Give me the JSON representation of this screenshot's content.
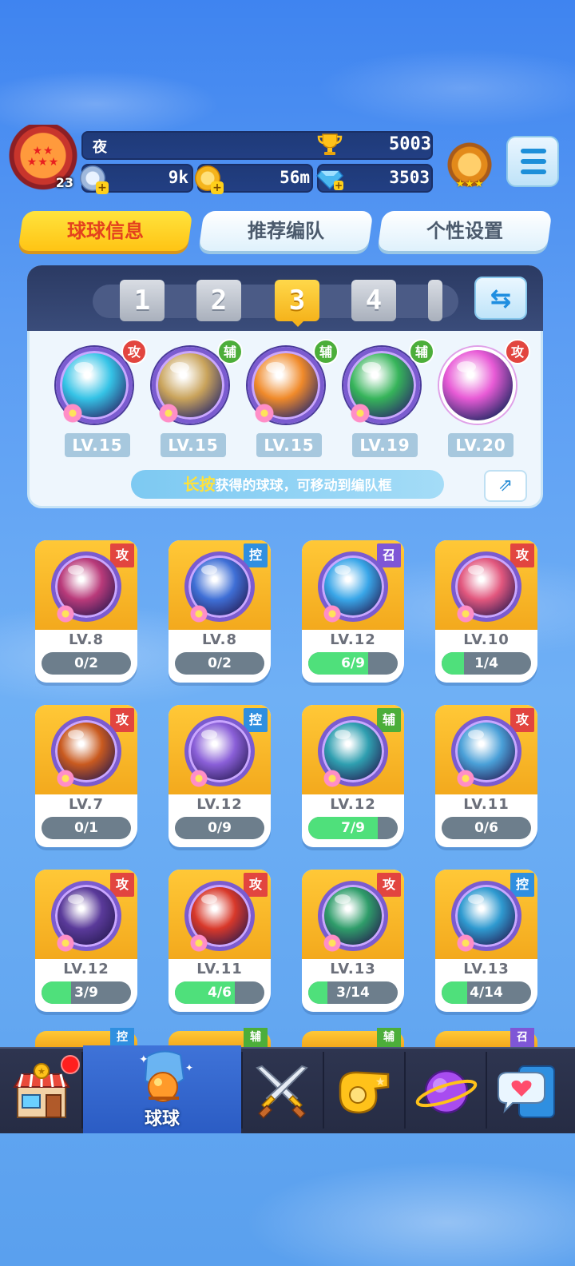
{
  "player": {
    "name": "夜",
    "level": "23",
    "trophies": "5003",
    "coins": "9k",
    "gold": "56m",
    "gems": "3503"
  },
  "tabs": [
    {
      "label": "球球信息",
      "active": true
    },
    {
      "label": "推荐编队",
      "active": false
    },
    {
      "label": "个性设置",
      "active": false
    }
  ],
  "team": {
    "slots": [
      "1",
      "2",
      "3",
      "4"
    ],
    "active_slot": "3",
    "balls": [
      {
        "type": "攻",
        "level": "LV.15",
        "color": "#35c3e6"
      },
      {
        "type": "辅",
        "level": "LV.15",
        "color": "#c9a35b"
      },
      {
        "type": "辅",
        "level": "LV.15",
        "color": "#f08a2a"
      },
      {
        "type": "辅",
        "level": "LV.19",
        "color": "#36b45a"
      },
      {
        "type": "攻",
        "level": "LV.20",
        "color": "#e85bd6"
      }
    ],
    "tip_highlight": "长按",
    "tip_text": "获得的球球，可移动到编队框"
  },
  "cards": [
    {
      "type": "攻",
      "level": "LV.8",
      "progress": "0/2",
      "fill": 0,
      "color": "#b93a7a"
    },
    {
      "type": "控",
      "level": "LV.8",
      "progress": "0/2",
      "fill": 0,
      "color": "#3f6fd6"
    },
    {
      "type": "召",
      "level": "LV.12",
      "progress": "6/9",
      "fill": 0.67,
      "color": "#39a6e8"
    },
    {
      "type": "攻",
      "level": "LV.10",
      "progress": "1/4",
      "fill": 0.25,
      "color": "#e2577e"
    },
    {
      "type": "攻",
      "level": "LV.7",
      "progress": "0/1",
      "fill": 0,
      "color": "#c95a1f"
    },
    {
      "type": "控",
      "level": "LV.12",
      "progress": "0/9",
      "fill": 0,
      "color": "#8a5fd8"
    },
    {
      "type": "辅",
      "level": "LV.12",
      "progress": "7/9",
      "fill": 0.78,
      "color": "#2f9fb0"
    },
    {
      "type": "攻",
      "level": "LV.11",
      "progress": "0/6",
      "fill": 0,
      "color": "#4aa0d8"
    },
    {
      "type": "攻",
      "level": "LV.12",
      "progress": "3/9",
      "fill": 0.33,
      "color": "#5a3a9a"
    },
    {
      "type": "攻",
      "level": "LV.11",
      "progress": "4/6",
      "fill": 0.67,
      "color": "#d8382a"
    },
    {
      "type": "攻",
      "level": "LV.13",
      "progress": "3/14",
      "fill": 0.21,
      "color": "#2f9d6a"
    },
    {
      "type": "控",
      "level": "LV.13",
      "progress": "4/14",
      "fill": 0.29,
      "color": "#2f9ad0"
    }
  ],
  "peek_cards": [
    "控",
    "辅",
    "辅",
    "召"
  ],
  "nav": {
    "active_label": "球球"
  },
  "colors": {
    "attack": "#e2453f",
    "support": "#4cae3a",
    "control": "#2f8fe0",
    "summon": "#7e56d6",
    "accent": "#ffc414"
  }
}
